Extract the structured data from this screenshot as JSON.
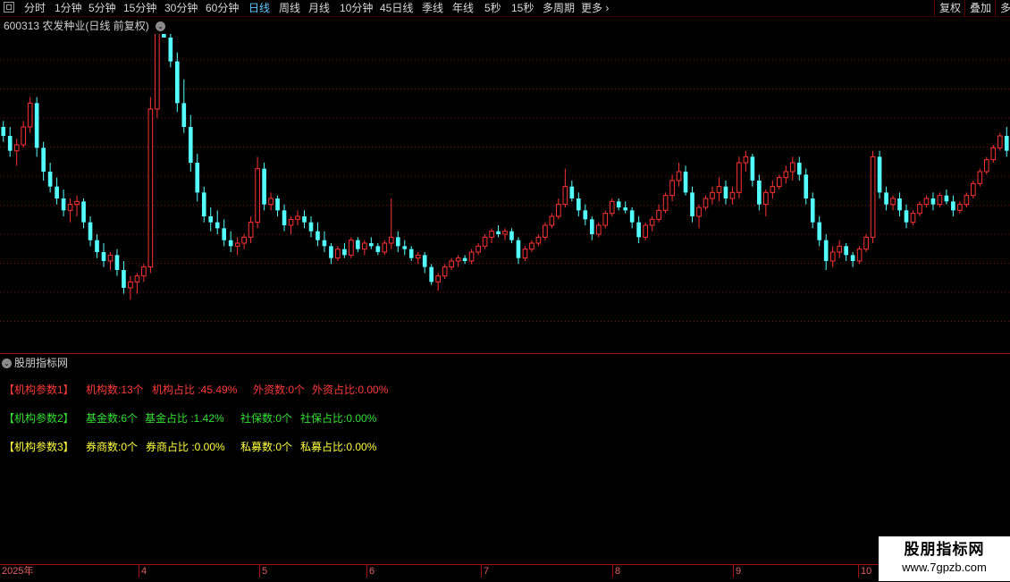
{
  "toolbar": {
    "timeframes": [
      "分时",
      "1分钟",
      "5分钟",
      "15分钟",
      "30分钟",
      "60分钟",
      "日线",
      "周线",
      "月线",
      "10分钟",
      "45日线",
      "季线",
      "年线",
      "5秒",
      "15秒",
      "多周期",
      "更多"
    ],
    "active": "日线",
    "right_buttons": [
      "复权",
      "叠加",
      "多"
    ]
  },
  "chart_title": {
    "code": "600313",
    "name": "农发种业",
    "mode": "(日线 前复权)"
  },
  "indicator": {
    "title": "股朋指标网",
    "rows": [
      {
        "label": "【机构参数1】",
        "items": [
          "机构数:13个",
          "机构占比 :45.49%",
          "外资数:0个",
          "外资占比:0.00%"
        ],
        "color": "#ff3b3b"
      },
      {
        "label": "【机构参数2】",
        "items": [
          "基金数:6个",
          "基金占比 :1.42%",
          "社保数:0个",
          "社保占比:0.00%"
        ],
        "color": "#35e035"
      },
      {
        "label": "【机构参数3】",
        "items": [
          "券商数:0个",
          "券商占比 :0.00%",
          "私募数:0个",
          "私募占比:0.00%"
        ],
        "color": "#ffff40"
      }
    ]
  },
  "date_axis": [
    "2025年",
    "4",
    "5",
    "6",
    "7",
    "8",
    "9",
    "10"
  ],
  "watermark": {
    "title": "股朋指标网",
    "url": "www.7gpzb.com"
  },
  "chart_data": {
    "type": "candlestick",
    "colors": {
      "up": "#ff3232",
      "down": "#54ffff"
    },
    "price_range": [
      1,
      100
    ],
    "candles": [
      [
        70,
        72,
        65,
        67
      ],
      [
        67,
        70,
        60,
        62
      ],
      [
        62,
        66,
        57,
        64
      ],
      [
        64,
        72,
        63,
        70
      ],
      [
        70,
        80,
        68,
        78
      ],
      [
        78,
        80,
        60,
        63
      ],
      [
        63,
        65,
        52,
        55
      ],
      [
        55,
        58,
        48,
        50
      ],
      [
        50,
        53,
        44,
        46
      ],
      [
        46,
        49,
        40,
        42
      ],
      [
        42,
        46,
        38,
        44
      ],
      [
        44,
        47,
        40,
        45
      ],
      [
        45,
        46,
        36,
        38
      ],
      [
        38,
        40,
        30,
        32
      ],
      [
        32,
        34,
        26,
        28
      ],
      [
        28,
        31,
        23,
        25
      ],
      [
        25,
        28,
        22,
        27
      ],
      [
        27,
        29,
        20,
        22
      ],
      [
        22,
        25,
        14,
        16
      ],
      [
        16,
        20,
        12,
        18
      ],
      [
        18,
        21,
        14,
        20
      ],
      [
        20,
        24,
        18,
        23
      ],
      [
        23,
        80,
        21,
        76
      ],
      [
        76,
        120,
        73,
        118
      ],
      [
        118,
        185,
        105,
        100
      ],
      [
        100,
        122,
        90,
        92
      ],
      [
        92,
        95,
        75,
        78
      ],
      [
        78,
        86,
        68,
        70
      ],
      [
        70,
        74,
        55,
        58
      ],
      [
        58,
        61,
        45,
        48
      ],
      [
        48,
        50,
        38,
        40
      ],
      [
        40,
        43,
        35,
        38
      ],
      [
        38,
        42,
        34,
        36
      ],
      [
        36,
        39,
        30,
        32
      ],
      [
        32,
        35,
        28,
        30
      ],
      [
        30,
        33,
        27,
        31
      ],
      [
        31,
        34,
        29,
        33
      ],
      [
        33,
        40,
        31,
        38
      ],
      [
        38,
        60,
        36,
        56
      ],
      [
        56,
        58,
        42,
        44
      ],
      [
        44,
        48,
        42,
        46
      ],
      [
        46,
        47,
        40,
        42
      ],
      [
        42,
        44,
        35,
        37
      ],
      [
        37,
        40,
        34,
        39
      ],
      [
        39,
        42,
        37,
        40
      ],
      [
        40,
        42,
        36,
        38
      ],
      [
        38,
        40,
        33,
        35
      ],
      [
        35,
        38,
        30,
        32
      ],
      [
        32,
        35,
        28,
        30
      ],
      [
        30,
        31,
        24,
        26
      ],
      [
        26,
        30,
        25,
        29
      ],
      [
        29,
        31,
        26,
        27
      ],
      [
        27,
        33,
        26,
        32
      ],
      [
        32,
        33,
        28,
        29
      ],
      [
        29,
        32,
        27,
        31
      ],
      [
        31,
        33,
        29,
        30
      ],
      [
        30,
        31,
        27,
        28
      ],
      [
        28,
        32,
        27,
        31
      ],
      [
        31,
        46,
        29,
        33
      ],
      [
        33,
        35,
        28,
        30
      ],
      [
        30,
        32,
        27,
        29
      ],
      [
        29,
        30,
        25,
        26
      ],
      [
        26,
        28,
        24,
        27
      ],
      [
        27,
        28,
        21,
        23
      ],
      [
        23,
        24,
        17,
        18
      ],
      [
        18,
        21,
        15,
        20
      ],
      [
        20,
        24,
        19,
        23
      ],
      [
        23,
        26,
        22,
        25
      ],
      [
        25,
        27,
        23,
        26
      ],
      [
        26,
        27,
        24,
        25
      ],
      [
        25,
        29,
        24,
        28
      ],
      [
        28,
        31,
        27,
        30
      ],
      [
        30,
        34,
        29,
        33
      ],
      [
        33,
        36,
        31,
        35
      ],
      [
        35,
        37,
        33,
        34
      ],
      [
        34,
        36,
        32,
        35
      ],
      [
        35,
        36,
        31,
        32
      ],
      [
        32,
        33,
        24,
        26
      ],
      [
        26,
        30,
        25,
        29
      ],
      [
        29,
        32,
        28,
        31
      ],
      [
        31,
        34,
        30,
        33
      ],
      [
        33,
        38,
        32,
        37
      ],
      [
        37,
        41,
        36,
        40
      ],
      [
        40,
        46,
        39,
        44
      ],
      [
        44,
        56,
        43,
        50
      ],
      [
        50,
        52,
        45,
        46
      ],
      [
        46,
        48,
        40,
        42
      ],
      [
        42,
        44,
        37,
        39
      ],
      [
        39,
        40,
        32,
        34
      ],
      [
        34,
        38,
        33,
        37
      ],
      [
        37,
        42,
        36,
        41
      ],
      [
        41,
        46,
        40,
        45
      ],
      [
        45,
        46,
        42,
        43
      ],
      [
        43,
        45,
        41,
        42
      ],
      [
        42,
        43,
        36,
        38
      ],
      [
        38,
        40,
        31,
        33
      ],
      [
        33,
        38,
        32,
        37
      ],
      [
        37,
        40,
        35,
        39
      ],
      [
        39,
        44,
        38,
        42
      ],
      [
        42,
        48,
        41,
        47
      ],
      [
        47,
        54,
        45,
        52
      ],
      [
        52,
        58,
        50,
        55
      ],
      [
        55,
        57,
        47,
        48
      ],
      [
        48,
        50,
        38,
        40
      ],
      [
        40,
        44,
        36,
        43
      ],
      [
        43,
        47,
        42,
        46
      ],
      [
        46,
        50,
        44,
        48
      ],
      [
        48,
        53,
        45,
        50
      ],
      [
        50,
        52,
        44,
        46
      ],
      [
        46,
        50,
        44,
        48
      ],
      [
        48,
        60,
        46,
        58
      ],
      [
        58,
        62,
        55,
        60
      ],
      [
        60,
        61,
        50,
        52
      ],
      [
        52,
        54,
        42,
        44
      ],
      [
        44,
        49,
        40,
        48
      ],
      [
        48,
        52,
        46,
        50
      ],
      [
        50,
        54,
        49,
        53
      ],
      [
        53,
        57,
        51,
        55
      ],
      [
        55,
        60,
        52,
        58
      ],
      [
        58,
        60,
        52,
        54
      ],
      [
        54,
        56,
        44,
        46
      ],
      [
        46,
        48,
        36,
        38
      ],
      [
        38,
        40,
        30,
        32
      ],
      [
        32,
        34,
        22,
        25
      ],
      [
        25,
        30,
        23,
        28
      ],
      [
        28,
        32,
        26,
        30
      ],
      [
        30,
        31,
        25,
        27
      ],
      [
        27,
        28,
        23,
        25
      ],
      [
        25,
        30,
        24,
        29
      ],
      [
        29,
        34,
        28,
        33
      ],
      [
        33,
        62,
        31,
        60
      ],
      [
        60,
        62,
        46,
        48
      ],
      [
        48,
        50,
        42,
        44
      ],
      [
        44,
        47,
        42,
        46
      ],
      [
        46,
        48,
        40,
        42
      ],
      [
        42,
        44,
        36,
        38
      ],
      [
        38,
        42,
        37,
        41
      ],
      [
        41,
        45,
        40,
        44
      ],
      [
        44,
        47,
        43,
        46
      ],
      [
        46,
        48,
        42,
        44
      ],
      [
        44,
        48,
        43,
        47
      ],
      [
        47,
        49,
        44,
        45
      ],
      [
        45,
        47,
        40,
        42
      ],
      [
        42,
        45,
        41,
        44
      ],
      [
        44,
        48,
        43,
        47
      ],
      [
        47,
        52,
        46,
        51
      ],
      [
        51,
        56,
        50,
        55
      ],
      [
        55,
        60,
        54,
        59
      ],
      [
        59,
        64,
        58,
        63
      ],
      [
        63,
        68,
        62,
        67
      ],
      [
        67,
        70,
        60,
        62
      ]
    ]
  }
}
